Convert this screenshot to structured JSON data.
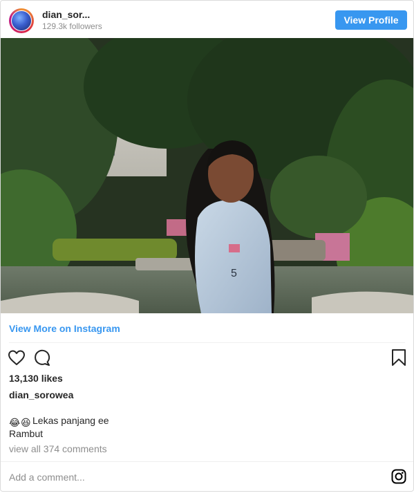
{
  "header": {
    "username": "dian_sor...",
    "followers": "129.3k followers",
    "view_profile_label": "View Profile"
  },
  "photo": {
    "alt": "Photo by dian_sorowea"
  },
  "view_more_label": "View More on Instagram",
  "actions": {
    "like_icon": "heart-icon",
    "comment_icon": "comment-icon",
    "save_icon": "bookmark-icon"
  },
  "likes": "13,130 likes",
  "owner": "dian_sorowea",
  "caption": {
    "emojis": [
      "😂",
      "😆"
    ],
    "line1": "Lekas panjang ee",
    "line2": "Rambut"
  },
  "comments_link": "view all 374 comments",
  "comment_placeholder": "Add a comment...",
  "colors": {
    "accent": "#3897f0",
    "muted": "#8e8e8e",
    "text": "#262626"
  },
  "brand_icon": "instagram-icon"
}
